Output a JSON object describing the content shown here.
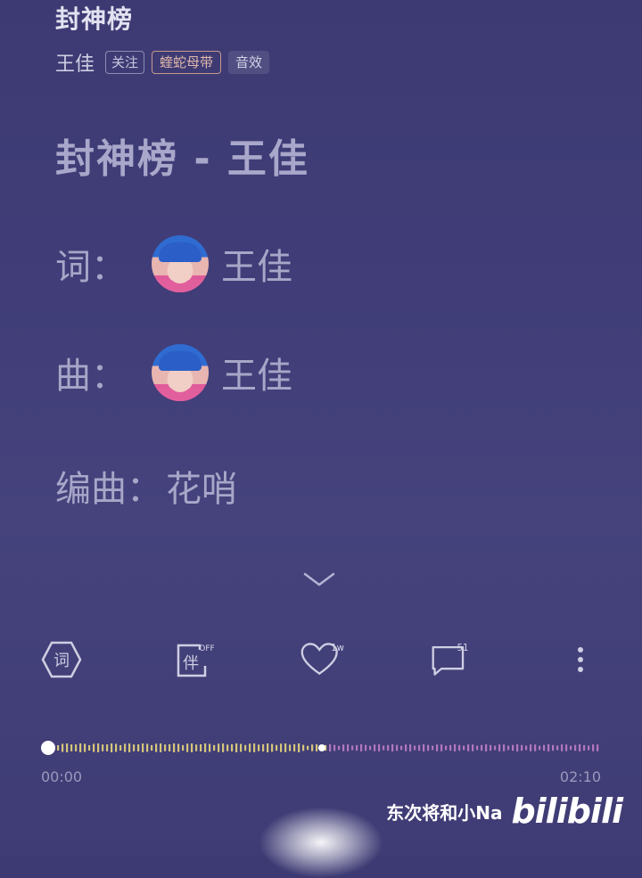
{
  "header": {
    "song_title": "封神榜",
    "artist": "王佳",
    "follow_label": "关注",
    "effect_tag": "蝰蛇母带",
    "sound_effect_label": "音效"
  },
  "lyrics": {
    "heading": "封神榜 - 王佳",
    "lyricist_label": "词：",
    "lyricist_name": "王佳",
    "composer_label": "曲：",
    "composer_name": "王佳",
    "arranger_label": "编曲：",
    "arranger_name": "花哨"
  },
  "controls": {
    "lyrics_icon_char": "词",
    "accompaniment_icon_char": "伴",
    "accompaniment_state": "OFF",
    "like_count": "1w",
    "comment_count": "51"
  },
  "player": {
    "current_time": "00:00",
    "total_time": "02:10",
    "progress": 0.0
  },
  "watermark": {
    "user": "东次将和小Na",
    "logo": "bilibili"
  },
  "colors": {
    "background": "#403d78",
    "accent_yellow": "#e6d57a",
    "accent_pink": "#d98bd6"
  }
}
